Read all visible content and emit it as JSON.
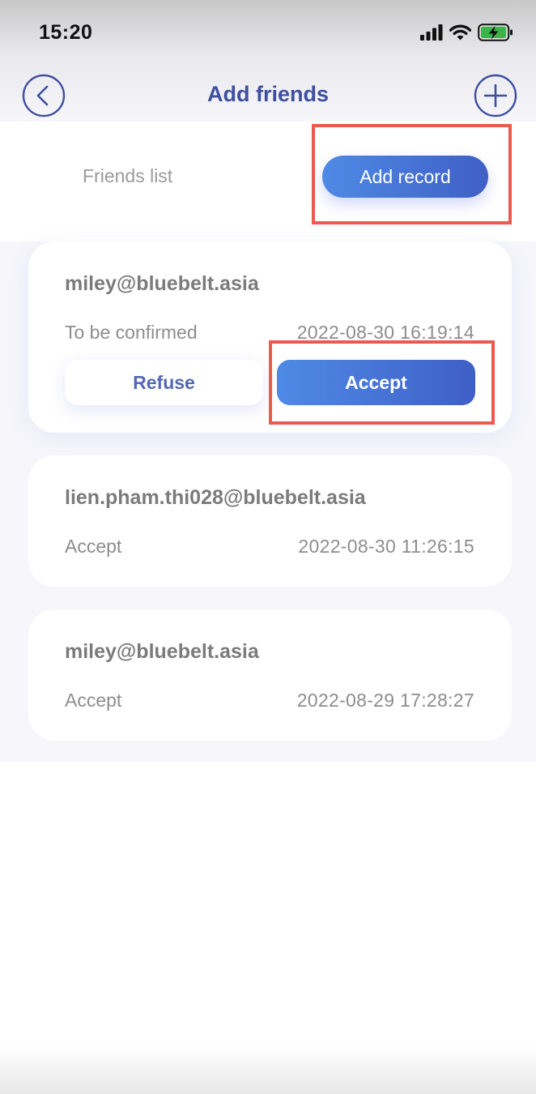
{
  "status_bar": {
    "time": "15:20",
    "icons": [
      "signal-icon",
      "wifi-icon",
      "battery-charging-icon"
    ],
    "battery_color": "#3bb54a"
  },
  "header": {
    "title": "Add friends",
    "back_icon": "chevron-left-icon",
    "add_icon": "plus-icon"
  },
  "tabs": {
    "friends_list": "Friends list",
    "add_record": "Add record",
    "active": "add_record"
  },
  "records": [
    {
      "email": "miley@bluebelt.asia",
      "status": "To be confirmed",
      "time": "2022-08-30 16:19:14",
      "actions": {
        "refuse": "Refuse",
        "accept": "Accept"
      }
    },
    {
      "email": "lien.pham.thi028@bluebelt.asia",
      "status": "Accept",
      "time": "2022-08-30 11:26:15"
    },
    {
      "email": "miley@bluebelt.asia",
      "status": "Accept",
      "time": "2022-08-29 17:28:27"
    }
  ],
  "colors": {
    "accent": "#3d4f9e",
    "button_gradient_start": "#4f8ae6",
    "button_gradient_end": "#3f5fc6",
    "highlight": "#ec5a4f"
  }
}
